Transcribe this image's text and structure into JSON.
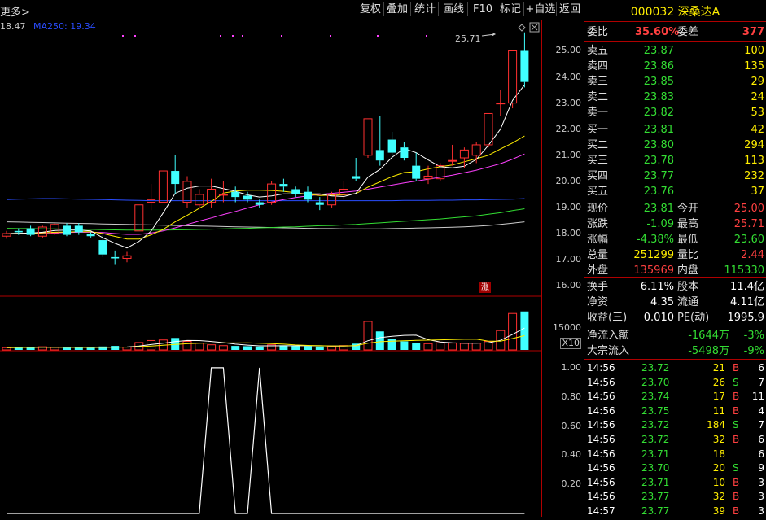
{
  "toolbar": {
    "more": "更多>",
    "buttons": [
      "复权",
      "叠加",
      "统计",
      "画线",
      "F10",
      "标记",
      "+自选",
      "返回"
    ]
  },
  "legend": {
    "prev_ma": "18.47",
    "ma250_label": "MA250: 19.34"
  },
  "price_axis": [
    "25.00",
    "24.00",
    "23.00",
    "22.00",
    "21.00",
    "20.00",
    "19.00",
    "18.00",
    "17.00",
    "16.00"
  ],
  "volume_axis": {
    "value": "15000",
    "unit": "X10"
  },
  "indicator_axis": [
    "1.00",
    "0.80",
    "0.60",
    "0.40",
    "0.20"
  ],
  "high_marker": "25.71",
  "limit_up_badge": "涨",
  "stock": {
    "code": "000032",
    "name": "深桑达A"
  },
  "order_book": {
    "wei_bi_label": "委比",
    "wei_bi": "35.60%",
    "wei_cha_label": "委差",
    "wei_cha": "377",
    "asks": [
      {
        "label": "卖五",
        "price": "23.87",
        "vol": "100"
      },
      {
        "label": "卖四",
        "price": "23.86",
        "vol": "135"
      },
      {
        "label": "卖三",
        "price": "23.85",
        "vol": "29"
      },
      {
        "label": "卖二",
        "price": "23.83",
        "vol": "24"
      },
      {
        "label": "卖一",
        "price": "23.82",
        "vol": "53"
      }
    ],
    "bids": [
      {
        "label": "买一",
        "price": "23.81",
        "vol": "42"
      },
      {
        "label": "买二",
        "price": "23.80",
        "vol": "294"
      },
      {
        "label": "买三",
        "price": "23.78",
        "vol": "113"
      },
      {
        "label": "买四",
        "price": "23.77",
        "vol": "232"
      },
      {
        "label": "买五",
        "price": "23.76",
        "vol": "37"
      }
    ]
  },
  "quote": [
    {
      "l1": "现价",
      "v1": "23.81",
      "c1": "green",
      "l2": "今开",
      "v2": "25.00",
      "c2": "red"
    },
    {
      "l1": "涨跌",
      "v1": "-1.09",
      "c1": "green",
      "l2": "最高",
      "v2": "25.71",
      "c2": "red"
    },
    {
      "l1": "涨幅",
      "v1": "-4.38%",
      "c1": "green",
      "l2": "最低",
      "v2": "23.60",
      "c2": "green"
    },
    {
      "l1": "总量",
      "v1": "251299",
      "c1": "yellow",
      "l2": "量比",
      "v2": "2.44",
      "c2": "red"
    },
    {
      "l1": "外盘",
      "v1": "135969",
      "c1": "red",
      "l2": "内盘",
      "v2": "115330",
      "c2": "green"
    }
  ],
  "fundamentals": [
    {
      "l1": "换手",
      "v1": "6.11%",
      "l2": "股本",
      "v2": "11.4亿"
    },
    {
      "l1": "净资",
      "v1": "4.35",
      "l2": "流通",
      "v2": "4.11亿"
    },
    {
      "l1": "收益(三)",
      "v1": "0.010",
      "l2": "PE(动)",
      "v2": "1995.9"
    }
  ],
  "flows": [
    {
      "label": "净流入额",
      "amount": "-1644万",
      "pct": "-3%"
    },
    {
      "label": "大宗流入",
      "amount": "-5498万",
      "pct": "-9%"
    }
  ],
  "trades": [
    {
      "t": "14:56",
      "p": "23.72",
      "v": "21",
      "s": "B",
      "n": "6"
    },
    {
      "t": "14:56",
      "p": "23.70",
      "v": "26",
      "s": "S",
      "n": "7"
    },
    {
      "t": "14:56",
      "p": "23.74",
      "v": "17",
      "s": "B",
      "n": "11"
    },
    {
      "t": "14:56",
      "p": "23.75",
      "v": "11",
      "s": "B",
      "n": "4"
    },
    {
      "t": "14:56",
      "p": "23.72",
      "v": "184",
      "s": "S",
      "n": "7"
    },
    {
      "t": "14:56",
      "p": "23.72",
      "v": "32",
      "s": "B",
      "n": "6"
    },
    {
      "t": "14:56",
      "p": "23.71",
      "v": "18",
      "s": "",
      "n": "6"
    },
    {
      "t": "14:56",
      "p": "23.70",
      "v": "20",
      "s": "S",
      "n": "9"
    },
    {
      "t": "14:56",
      "p": "23.71",
      "v": "10",
      "s": "B",
      "n": "3"
    },
    {
      "t": "14:56",
      "p": "23.77",
      "v": "32",
      "s": "B",
      "n": "3"
    },
    {
      "t": "14:57",
      "p": "23.77",
      "v": "39",
      "s": "B",
      "n": "3"
    }
  ],
  "colors": {
    "up": "#ff3030",
    "down": "#40ffff",
    "ma5": "#ffffff",
    "ma10": "#ffee00",
    "ma20": "#ff40ff",
    "ma60": "#33dd33",
    "ma120": "#cccccc",
    "ma250": "#2a4dff"
  },
  "chart_data": {
    "type": "candlestick",
    "price_range": [
      15.6,
      26.2
    ],
    "candles": [
      [
        17.9,
        18.1,
        17.8,
        18.0
      ],
      [
        18.1,
        18.2,
        17.95,
        18.05
      ],
      [
        18.2,
        18.3,
        17.9,
        17.95
      ],
      [
        17.9,
        18.3,
        17.85,
        18.25
      ],
      [
        18.0,
        18.4,
        17.95,
        18.35
      ],
      [
        18.3,
        18.4,
        17.9,
        17.95
      ],
      [
        18.3,
        18.4,
        17.95,
        18.05
      ],
      [
        18.0,
        18.05,
        17.85,
        17.9
      ],
      [
        17.75,
        17.95,
        17.1,
        17.2
      ],
      [
        17.1,
        17.35,
        16.8,
        17.05
      ],
      [
        17.05,
        17.3,
        16.9,
        17.15
      ],
      [
        18.1,
        19.1,
        18.1,
        19.1
      ],
      [
        19.2,
        19.9,
        18.9,
        19.3
      ],
      [
        19.2,
        20.4,
        19.2,
        20.4
      ],
      [
        20.4,
        21.0,
        19.5,
        19.9
      ],
      [
        19.2,
        20.2,
        19.0,
        20.0
      ],
      [
        19.1,
        19.7,
        19.0,
        19.5
      ],
      [
        19.2,
        20.1,
        19.0,
        19.7
      ],
      [
        19.5,
        20.0,
        19.2,
        19.5
      ],
      [
        19.6,
        19.8,
        19.2,
        19.4
      ],
      [
        19.45,
        19.6,
        19.2,
        19.3
      ],
      [
        19.2,
        19.3,
        19.0,
        19.1
      ],
      [
        19.2,
        20.0,
        19.1,
        19.9
      ],
      [
        19.9,
        20.1,
        19.6,
        19.8
      ],
      [
        19.7,
        19.8,
        19.4,
        19.5
      ],
      [
        19.6,
        19.8,
        19.2,
        19.3
      ],
      [
        19.2,
        19.4,
        18.9,
        19.1
      ],
      [
        19.1,
        19.6,
        19.0,
        19.5
      ],
      [
        19.5,
        20.0,
        19.3,
        19.7
      ],
      [
        20.2,
        20.9,
        20.0,
        20.1
      ],
      [
        21.0,
        22.4,
        20.9,
        22.4
      ],
      [
        21.2,
        22.5,
        20.6,
        20.8
      ],
      [
        21.6,
        21.9,
        20.9,
        21.1
      ],
      [
        21.3,
        21.5,
        20.8,
        20.9
      ],
      [
        20.6,
        21.1,
        20.0,
        20.1
      ],
      [
        20.1,
        20.6,
        19.9,
        20.2
      ],
      [
        20.1,
        20.7,
        20.0,
        20.6
      ],
      [
        20.8,
        21.4,
        20.6,
        20.8
      ],
      [
        20.9,
        21.3,
        20.5,
        21.2
      ],
      [
        21.0,
        21.5,
        20.7,
        21.4
      ],
      [
        21.4,
        22.6,
        21.3,
        22.6
      ],
      [
        23.0,
        23.5,
        22.5,
        23.0
      ],
      [
        23.0,
        25.0,
        22.8,
        25.0
      ],
      [
        25.0,
        25.71,
        23.6,
        23.81
      ]
    ],
    "volume_range": [
      0,
      18000
    ],
    "volumes": [
      800,
      900,
      1000,
      1100,
      900,
      800,
      800,
      700,
      1200,
      1400,
      1000,
      2600,
      3300,
      3500,
      4200,
      3000,
      2400,
      1800,
      1500,
      1400,
      1300,
      1200,
      1800,
      1600,
      1400,
      1300,
      1200,
      1300,
      1500,
      2200,
      10000,
      6500,
      3800,
      3000,
      2500,
      2200,
      2500,
      2400,
      2300,
      2400,
      3000,
      6800,
      12800,
      13500
    ],
    "ma5": [
      18.0,
      18.01,
      18.02,
      18.05,
      18.12,
      18.13,
      18.13,
      18.1,
      17.84,
      17.63,
      17.45,
      17.7,
      18.09,
      18.79,
      19.54,
      19.74,
      19.82,
      19.82,
      19.72,
      19.62,
      19.48,
      19.4,
      19.44,
      19.52,
      19.52,
      19.52,
      19.52,
      19.44,
      19.42,
      19.54,
      20.16,
      20.46,
      20.92,
      21.26,
      21.1,
      20.82,
      20.56,
      20.52,
      20.58,
      20.84,
      21.38,
      22.0,
      23.1,
      23.7
    ],
    "ma10": [
      18.0,
      18.01,
      18.01,
      18.03,
      18.05,
      18.06,
      18.07,
      18.07,
      18.0,
      17.89,
      17.79,
      17.79,
      17.95,
      18.16,
      18.45,
      18.7,
      18.97,
      19.23,
      19.55,
      19.63,
      19.66,
      19.66,
      19.65,
      19.62,
      19.57,
      19.5,
      19.46,
      19.47,
      19.48,
      19.53,
      19.78,
      19.98,
      20.18,
      20.34,
      20.37,
      20.48,
      20.56,
      20.63,
      20.75,
      20.87,
      21.0,
      21.24,
      21.47,
      21.74
    ],
    "ma20": [
      18.0,
      18.0,
      18.01,
      18.02,
      18.03,
      18.04,
      18.05,
      18.05,
      18.04,
      18.0,
      17.97,
      17.97,
      18.02,
      18.1,
      18.22,
      18.35,
      18.48,
      18.6,
      18.73,
      18.85,
      18.98,
      19.1,
      19.21,
      19.3,
      19.38,
      19.44,
      19.5,
      19.54,
      19.58,
      19.63,
      19.7,
      19.78,
      19.86,
      19.94,
      20.01,
      20.08,
      20.16,
      20.24,
      20.33,
      20.43,
      20.55,
      20.68,
      20.85,
      21.05
    ],
    "ma60": [
      18.2,
      18.19,
      18.19,
      18.18,
      18.18,
      18.17,
      18.17,
      18.16,
      18.15,
      18.14,
      18.13,
      18.13,
      18.13,
      18.13,
      18.14,
      18.15,
      18.16,
      18.17,
      18.18,
      18.19,
      18.2,
      18.22,
      18.23,
      18.25,
      18.26,
      18.28,
      18.3,
      18.31,
      18.33,
      18.35,
      18.38,
      18.41,
      18.44,
      18.47,
      18.5,
      18.53,
      18.56,
      18.6,
      18.64,
      18.68,
      18.74,
      18.8,
      18.88,
      18.95
    ],
    "ma120": [
      18.45,
      18.44,
      18.43,
      18.42,
      18.41,
      18.4,
      18.39,
      18.38,
      18.37,
      18.36,
      18.35,
      18.34,
      18.33,
      18.32,
      18.31,
      18.3,
      18.29,
      18.28,
      18.27,
      18.26,
      18.25,
      18.24,
      18.23,
      18.22,
      18.21,
      18.2,
      18.19,
      18.19,
      18.18,
      18.18,
      18.18,
      18.18,
      18.19,
      18.2,
      18.21,
      18.22,
      18.23,
      18.24,
      18.26,
      18.28,
      18.31,
      18.35,
      18.4,
      18.45
    ],
    "ma250": [
      19.3,
      19.32,
      19.33,
      19.34,
      19.34,
      19.33,
      19.32,
      19.31,
      19.3,
      19.29,
      19.28,
      19.27,
      19.26,
      19.26,
      19.26,
      19.26,
      19.26,
      19.26,
      19.26,
      19.26,
      19.26,
      19.26,
      19.26,
      19.26,
      19.26,
      19.26,
      19.26,
      19.26,
      19.26,
      19.26,
      19.26,
      19.26,
      19.26,
      19.27,
      19.27,
      19.27,
      19.28,
      19.28,
      19.29,
      19.29,
      19.3,
      19.31,
      19.32,
      19.34
    ],
    "indicator_range": [
      0,
      1.1
    ],
    "indicator": [
      0,
      0,
      0,
      0,
      0,
      0,
      0,
      0,
      0,
      0,
      0,
      0,
      0,
      0,
      0,
      0,
      0,
      1,
      1,
      0,
      0,
      1,
      0,
      0,
      0,
      0,
      0,
      0,
      0,
      0,
      0,
      0,
      0,
      0,
      0,
      0,
      0,
      0,
      0,
      0,
      0,
      0,
      0,
      0
    ]
  }
}
